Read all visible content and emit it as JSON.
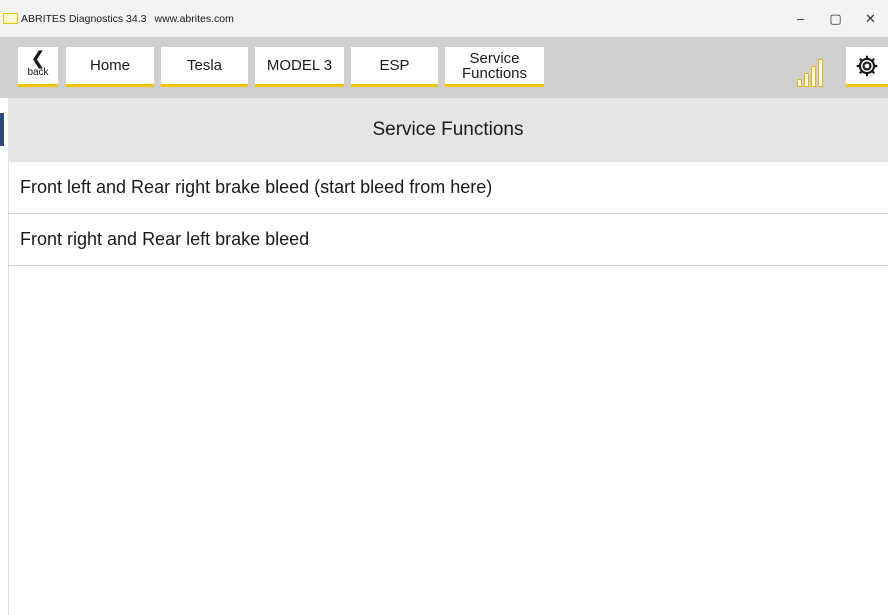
{
  "window": {
    "app_name": "ABRITES Diagnostics 34.3",
    "url": "www.abrites.com",
    "minimize": "–",
    "maximize": "▢",
    "close": "✕"
  },
  "nav": {
    "back_label": "back",
    "back_glyph": "❮",
    "breadcrumbs": [
      "Home",
      "Tesla",
      "MODEL 3",
      "ESP"
    ],
    "current_line1": "Service",
    "current_line2": "Functions"
  },
  "icons": {
    "signal": "signal-strength-icon",
    "settings": "gear-icon",
    "accent_color": "#f2c200"
  },
  "page": {
    "title": "Service Functions",
    "items": [
      "Front left and Rear right brake bleed (start bleed from here)",
      "Front right and Rear left brake bleed"
    ]
  }
}
